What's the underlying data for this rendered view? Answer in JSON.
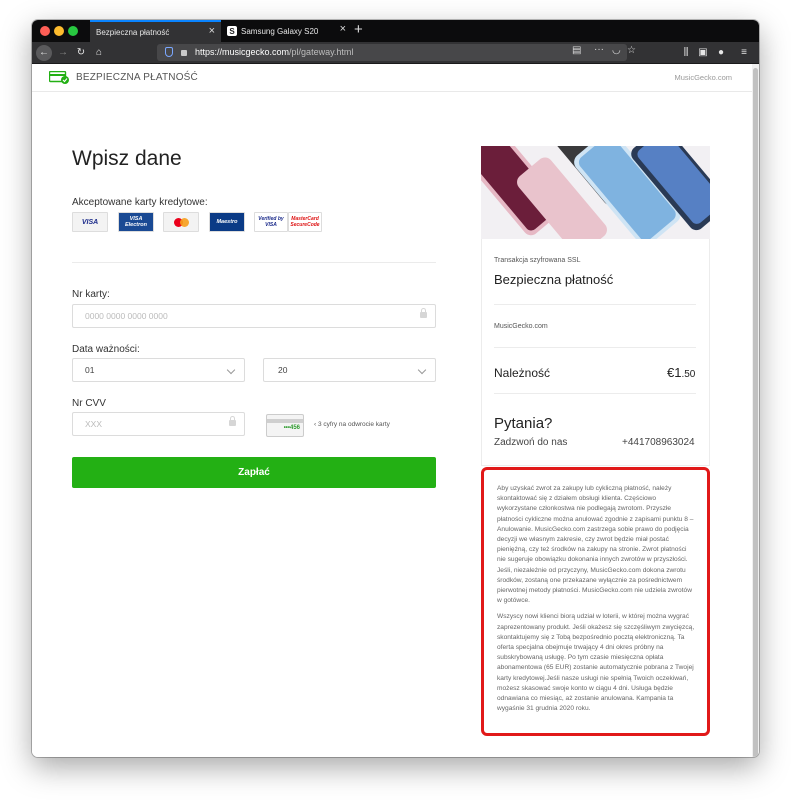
{
  "browser": {
    "tabs": [
      {
        "title": "Bezpieczna płatność",
        "active": true
      },
      {
        "title": "Samsung Galaxy S20",
        "favicon": "S",
        "active": false
      }
    ],
    "url_host": "https://musicgecko.com",
    "url_path": "/pl/gateway.html"
  },
  "header": {
    "brand": "BEZPIECZNA PŁATNOŚĆ",
    "site": "MusicGecko.com"
  },
  "form": {
    "heading": "Wpisz dane",
    "cards_label": "Akceptowane karty kredytowe:",
    "cards": [
      "VISA",
      "VISA Electron",
      "MasterCard",
      "Maestro",
      "Verified by VISA",
      "MasterCard SecureCode"
    ],
    "card_number_label": "Nr karty:",
    "card_number_placeholder": "0000 0000 0000 0000",
    "expiry_label": "Data ważności:",
    "expiry_month": "01",
    "expiry_year": "20",
    "cvv_label": "Nr CVV",
    "cvv_placeholder": "XXX",
    "cvv_sample": "•••456",
    "cvv_hint": "3 cyfry na odwrocie karty",
    "pay_button": "Zapłać"
  },
  "summary": {
    "ssl": "Transakcja szyfrowana SSL",
    "title": "Bezpieczna płatność",
    "merchant": "MusicGecko.com",
    "due_label": "Należność",
    "due_amount_main": "€1",
    "due_amount_cents": ".50",
    "questions_title": "Pytania?",
    "call_label": "Zadzwoń do nas",
    "phone": "+441708963024"
  },
  "terms": {
    "paragraph1": "Aby uzyskać zwrot za zakupy lub cykliczną płatność, należy skontaktować się z działem obsługi klienta. Częściowo wykorzystane członkostwa nie podlegają zwrotom. Przyszłe płatności cykliczne można anulować zgodnie z zapisami punktu 8 – Anulowanie. MusicGecko.com zastrzega sobie prawo do podjęcia decyzji we własnym zakresie, czy zwrot będzie miał postać pieniężną, czy też środków na zakupy na stronie. Zwrot płatności nie sugeruje obowiązku dokonania innych zwrotów w przyszłości. Jeśli, niezależnie od przyczyny, MusicGecko.com dokona zwrotu środków, zostaną one przekazane wyłącznie za pośrednictwem pierwotnej metody płatności. MusicGecko.com nie udziela zwrotów w gotówce.",
    "paragraph2": "Wszyscy nowi klienci biorą udział w loterii, w której można wygrać zaprezentowany produkt. Jeśli okażesz się szczęśliwym zwycięzcą, skontaktujemy się z Tobą bezpośrednio pocztą elektroniczną. Ta oferta specjalna obejmuje trwający 4 dni okres próbny na subskrybowaną usługę. Po tym czasie miesięczna opłata abonamentowa (65 EUR) zostanie automatycznie pobrana z Twojej karty kredytowej.Jeśli nasze usługi nie spełnią Twoich oczekiwań, możesz skasować swoje konto w ciągu 4 dni. Usługa będzie odnawiana co miesiąc, aż zostanie anulowana. Kampania ta wygaśnie 31 grudnia 2020 roku."
  },
  "colors": {
    "accent_green": "#23b014",
    "highlight_red": "#e11919",
    "tab_accent": "#0a84ff"
  }
}
